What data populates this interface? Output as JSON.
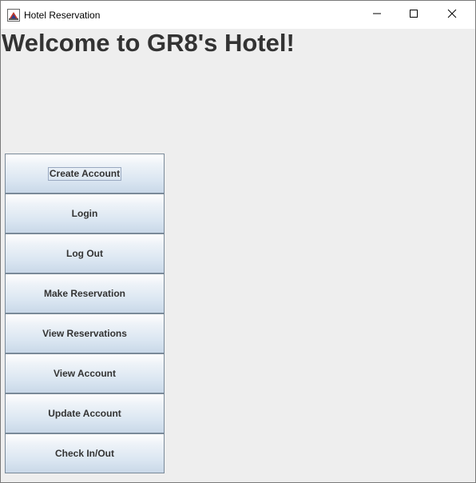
{
  "window": {
    "title": "Hotel Reservation",
    "icons": {
      "app": "java-app-icon",
      "minimize": "minimize-icon",
      "maximize": "maximize-icon",
      "close": "close-icon"
    }
  },
  "main": {
    "heading": "Welcome to GR8's Hotel!",
    "buttons": [
      {
        "label": "Create Account",
        "focused": true
      },
      {
        "label": "Login"
      },
      {
        "label": "Log Out"
      },
      {
        "label": "Make Reservation"
      },
      {
        "label": "View Reservations"
      },
      {
        "label": "View Account"
      },
      {
        "label": "Update Account"
      },
      {
        "label": "Check In/Out"
      }
    ]
  },
  "colors": {
    "background": "#eeeeee",
    "heading": "#333333",
    "button_border": "#7a8a99",
    "button_gradient_top": "#ffffff",
    "button_gradient_bottom": "#c9d8e8"
  }
}
